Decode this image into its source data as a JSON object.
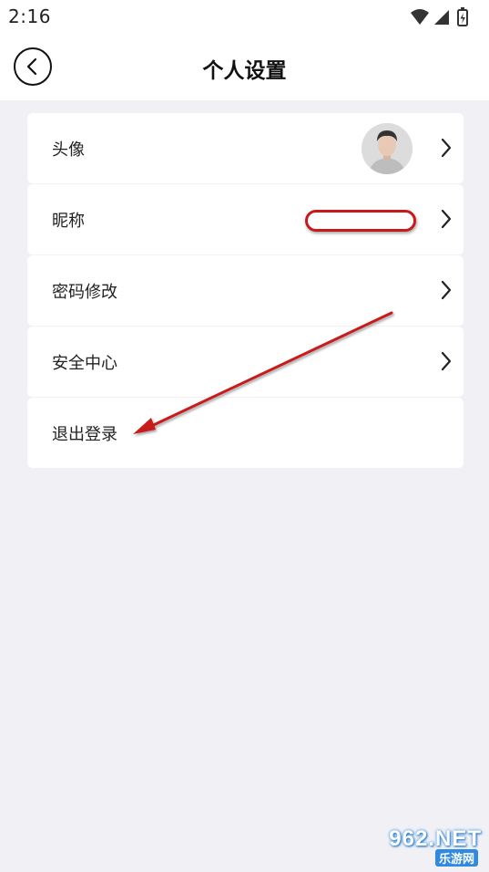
{
  "status_bar": {
    "time": "2:16",
    "icons": [
      "wifi-icon",
      "signal-icon",
      "battery-icon"
    ]
  },
  "header": {
    "title": "个人设置",
    "back_icon": "chevron-left-icon"
  },
  "settings": {
    "items": [
      {
        "label": "头像",
        "has_avatar": true
      },
      {
        "label": "昵称",
        "has_redacted_value": true
      },
      {
        "label": "密码修改"
      },
      {
        "label": "安全中心"
      },
      {
        "label": "退出登录"
      }
    ]
  },
  "watermark": {
    "main": "962.NET",
    "sub": "乐游网"
  },
  "colors": {
    "background": "#f0f0f5",
    "card": "#ffffff",
    "annotation_red": "#c81a1a",
    "watermark_blue": "#2f8ae0"
  }
}
